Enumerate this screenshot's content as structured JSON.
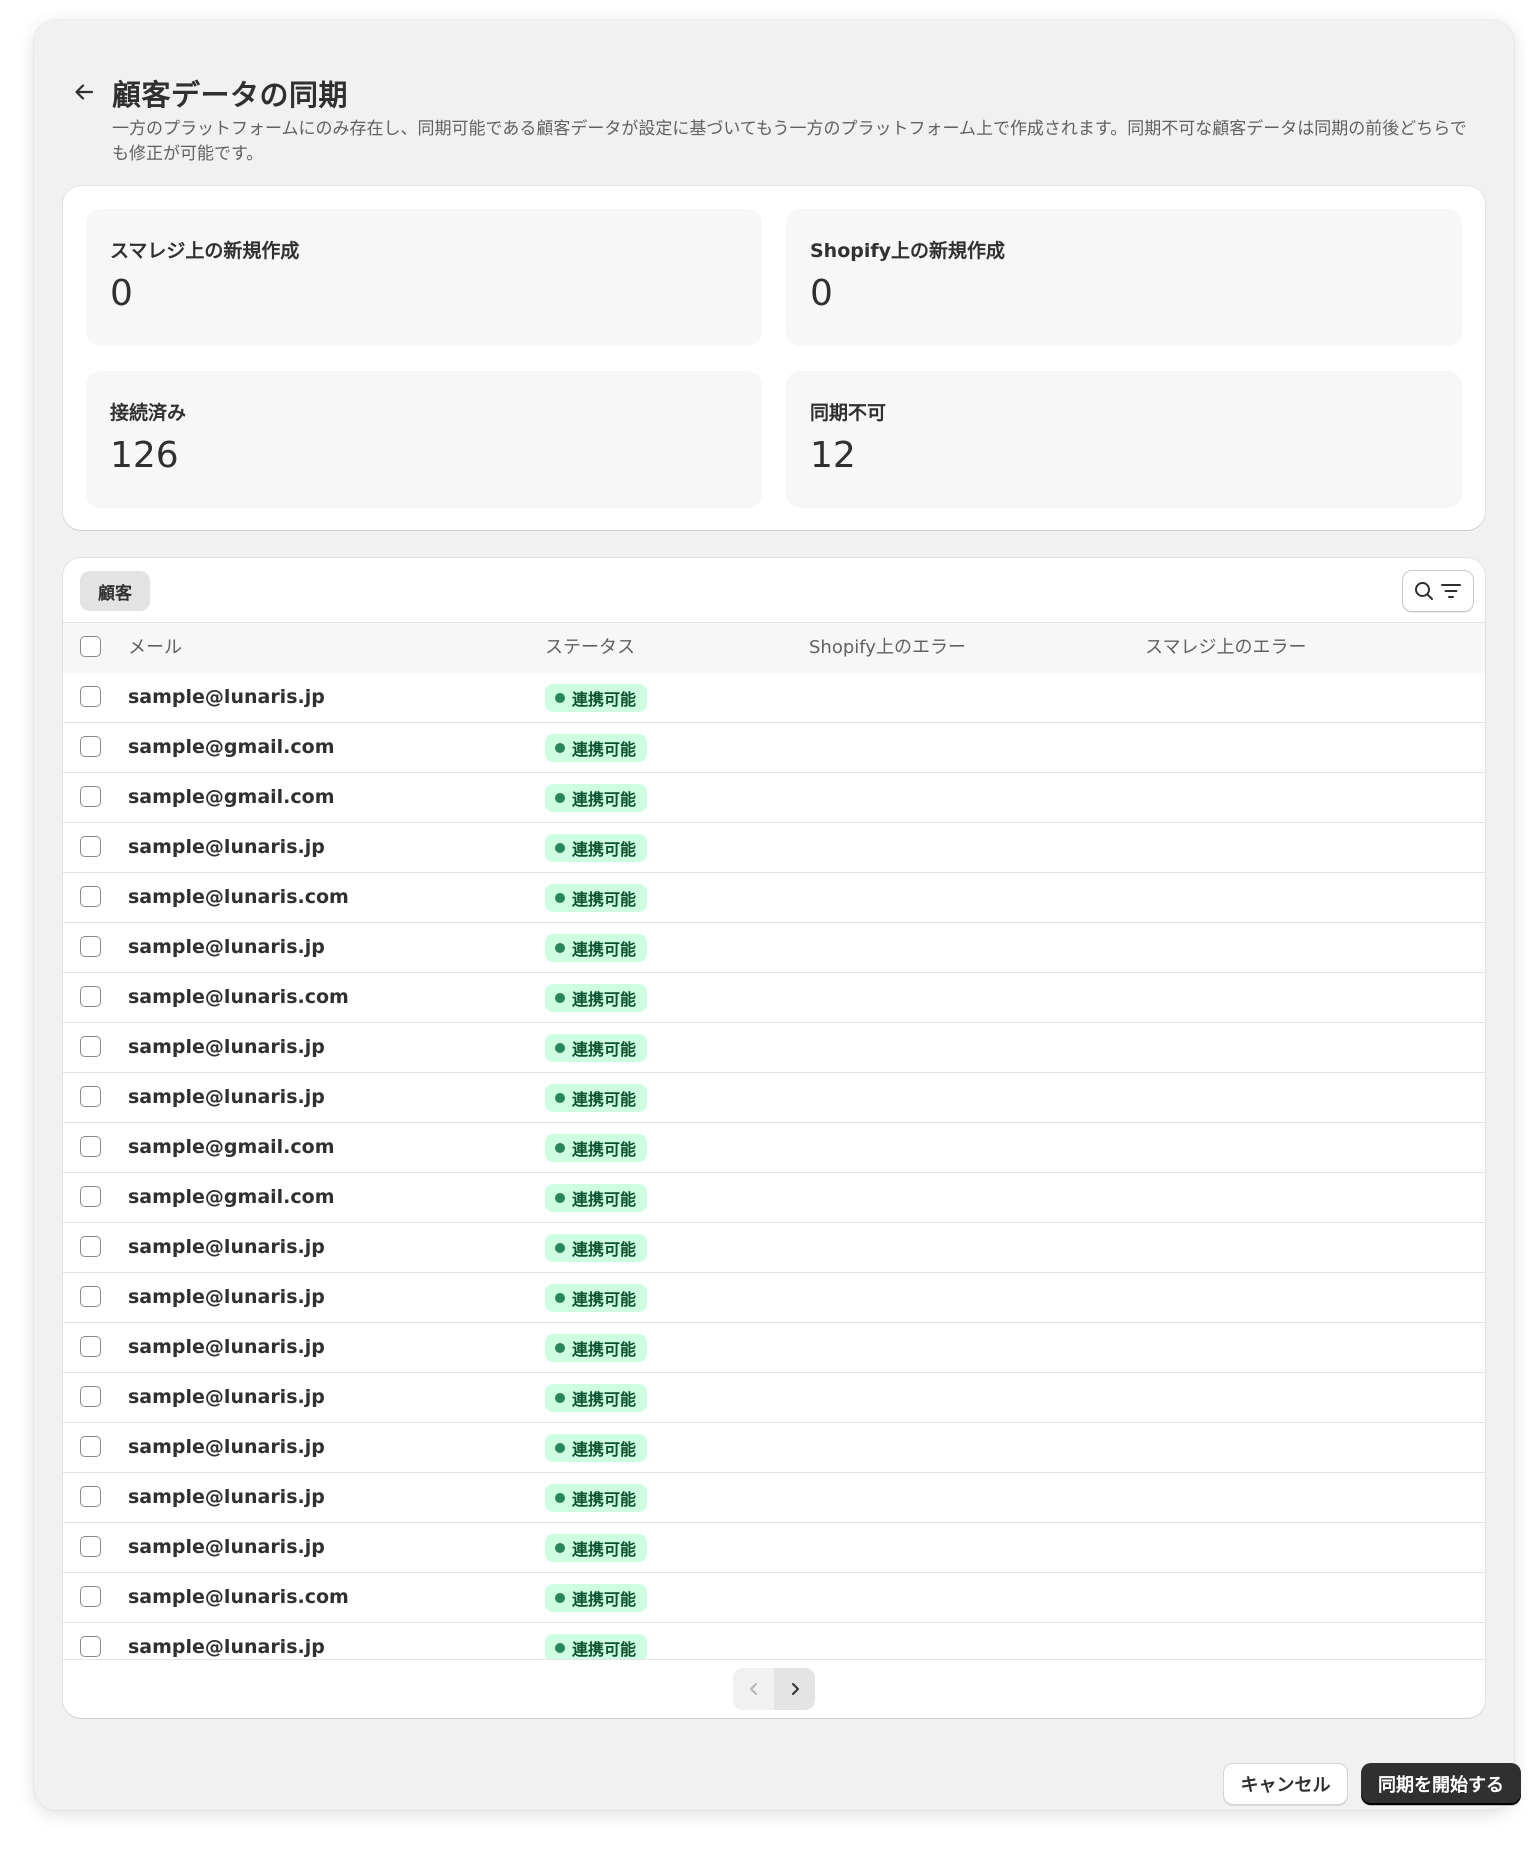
{
  "page": {
    "title": "顧客データの同期",
    "description": "一方のプラットフォームにのみ存在し、同期可能である顧客データが設定に基づいてもう一方のプラットフォーム上で作成されます。同期不可な顧客データは同期の前後どちらでも修正が可能です。"
  },
  "stats": [
    {
      "label": "スマレジ上の新規作成",
      "value": "0"
    },
    {
      "label": "Shopify上の新規作成",
      "value": "0"
    },
    {
      "label": "接続済み",
      "value": "126"
    },
    {
      "label": "同期不可",
      "value": "12"
    }
  ],
  "table": {
    "tab_label": "顧客",
    "columns": {
      "email": "メール",
      "status": "ステータス",
      "shopify_error": "Shopify上のエラー",
      "smaregi_error": "スマレジ上のエラー"
    },
    "status_color": "#cdfee1",
    "rows": [
      {
        "email": "sample@lunaris.jp",
        "status": "連携可能"
      },
      {
        "email": "sample@gmail.com",
        "status": "連携可能"
      },
      {
        "email": "sample@gmail.com",
        "status": "連携可能"
      },
      {
        "email": "sample@lunaris.jp",
        "status": "連携可能"
      },
      {
        "email": "sample@lunaris.com",
        "status": "連携可能"
      },
      {
        "email": "sample@lunaris.jp",
        "status": "連携可能"
      },
      {
        "email": "sample@lunaris.com",
        "status": "連携可能"
      },
      {
        "email": "sample@lunaris.jp",
        "status": "連携可能"
      },
      {
        "email": "sample@lunaris.jp",
        "status": "連携可能"
      },
      {
        "email": "sample@gmail.com",
        "status": "連携可能"
      },
      {
        "email": "sample@gmail.com",
        "status": "連携可能"
      },
      {
        "email": "sample@lunaris.jp",
        "status": "連携可能"
      },
      {
        "email": "sample@lunaris.jp",
        "status": "連携可能"
      },
      {
        "email": "sample@lunaris.jp",
        "status": "連携可能"
      },
      {
        "email": "sample@lunaris.jp",
        "status": "連携可能"
      },
      {
        "email": "sample@lunaris.jp",
        "status": "連携可能"
      },
      {
        "email": "sample@lunaris.jp",
        "status": "連携可能"
      },
      {
        "email": "sample@lunaris.jp",
        "status": "連携可能"
      },
      {
        "email": "sample@lunaris.com",
        "status": "連携可能"
      },
      {
        "email": "sample@lunaris.jp",
        "status": "連携可能"
      }
    ]
  },
  "footer": {
    "cancel_label": "キャンセル",
    "start_label": "同期を開始する"
  }
}
